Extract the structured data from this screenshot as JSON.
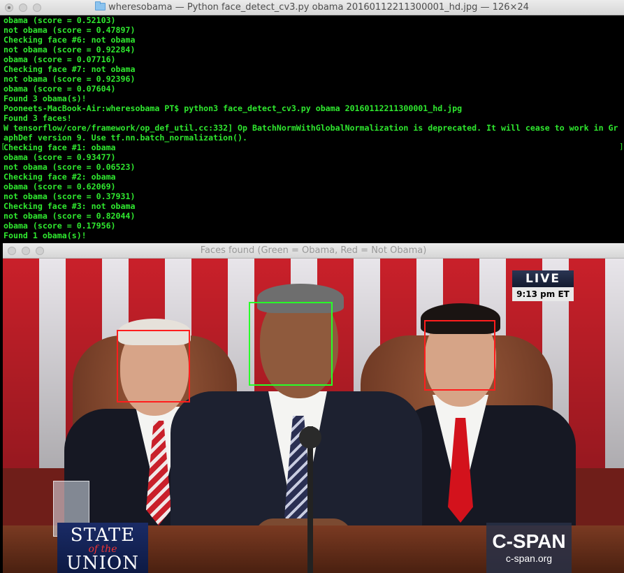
{
  "terminal": {
    "title": "wheresobama — Python face_detect_cv3.py obama 20160112211300001_hd.jpg — 126×24",
    "lines": [
      "obama (score = 0.52103)",
      "not obama (score = 0.47897)",
      "Checking face #6: not obama",
      "not obama (score = 0.92284)",
      "obama (score = 0.07716)",
      "Checking face #7: not obama",
      "not obama (score = 0.92396)",
      "obama (score = 0.07604)",
      "Found 3 obama(s)!",
      "Pooneets-MacBook-Air:wheresobama PT$ python3 face_detect_cv3.py obama 20160112211300001_hd.jpg",
      "Found 3 faces!",
      "W tensorflow/core/framework/op_def_util.cc:332] Op BatchNormWithGlobalNormalization is deprecated. It will cease to work in Gr",
      "aphDef version 9. Use tf.nn.batch_normalization().",
      "Checking face #1: obama",
      "obama (score = 0.93477)",
      "not obama (score = 0.06523)",
      "Checking face #2: obama",
      "obama (score = 0.62069)",
      "not obama (score = 0.37931)",
      "Checking face #3: not obama",
      "not obama (score = 0.82044)",
      "obama (score = 0.17956)",
      "Found 1 obama(s)!"
    ],
    "text_color": "#2fe82f"
  },
  "image_window": {
    "title": "Faces found (Green = Obama, Red = Not Obama)",
    "overlay": {
      "live": "LIVE",
      "time": "9:13 pm ET",
      "sotu_line1": "STATE",
      "sotu_line2": "of the",
      "sotu_line3": "UNION",
      "cspan_logo": "C-SPAN",
      "cspan_url": "c-span.org"
    },
    "box_colors": {
      "obama": "#28ff28",
      "not_obama": "#ff1d1d"
    }
  }
}
